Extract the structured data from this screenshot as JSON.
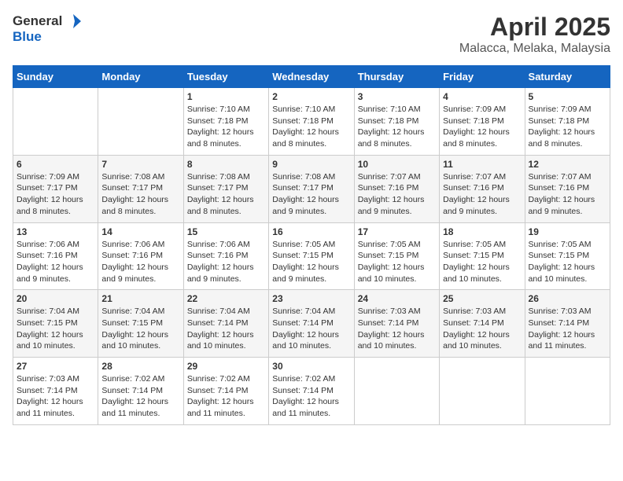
{
  "header": {
    "logo_general": "General",
    "logo_blue": "Blue",
    "title": "April 2025",
    "subtitle": "Malacca, Melaka, Malaysia"
  },
  "weekdays": [
    "Sunday",
    "Monday",
    "Tuesday",
    "Wednesday",
    "Thursday",
    "Friday",
    "Saturday"
  ],
  "weeks": [
    [
      {
        "day": "",
        "detail": ""
      },
      {
        "day": "",
        "detail": ""
      },
      {
        "day": "1",
        "detail": "Sunrise: 7:10 AM\nSunset: 7:18 PM\nDaylight: 12 hours\nand 8 minutes."
      },
      {
        "day": "2",
        "detail": "Sunrise: 7:10 AM\nSunset: 7:18 PM\nDaylight: 12 hours\nand 8 minutes."
      },
      {
        "day": "3",
        "detail": "Sunrise: 7:10 AM\nSunset: 7:18 PM\nDaylight: 12 hours\nand 8 minutes."
      },
      {
        "day": "4",
        "detail": "Sunrise: 7:09 AM\nSunset: 7:18 PM\nDaylight: 12 hours\nand 8 minutes."
      },
      {
        "day": "5",
        "detail": "Sunrise: 7:09 AM\nSunset: 7:18 PM\nDaylight: 12 hours\nand 8 minutes."
      }
    ],
    [
      {
        "day": "6",
        "detail": "Sunrise: 7:09 AM\nSunset: 7:17 PM\nDaylight: 12 hours\nand 8 minutes."
      },
      {
        "day": "7",
        "detail": "Sunrise: 7:08 AM\nSunset: 7:17 PM\nDaylight: 12 hours\nand 8 minutes."
      },
      {
        "day": "8",
        "detail": "Sunrise: 7:08 AM\nSunset: 7:17 PM\nDaylight: 12 hours\nand 8 minutes."
      },
      {
        "day": "9",
        "detail": "Sunrise: 7:08 AM\nSunset: 7:17 PM\nDaylight: 12 hours\nand 9 minutes."
      },
      {
        "day": "10",
        "detail": "Sunrise: 7:07 AM\nSunset: 7:16 PM\nDaylight: 12 hours\nand 9 minutes."
      },
      {
        "day": "11",
        "detail": "Sunrise: 7:07 AM\nSunset: 7:16 PM\nDaylight: 12 hours\nand 9 minutes."
      },
      {
        "day": "12",
        "detail": "Sunrise: 7:07 AM\nSunset: 7:16 PM\nDaylight: 12 hours\nand 9 minutes."
      }
    ],
    [
      {
        "day": "13",
        "detail": "Sunrise: 7:06 AM\nSunset: 7:16 PM\nDaylight: 12 hours\nand 9 minutes."
      },
      {
        "day": "14",
        "detail": "Sunrise: 7:06 AM\nSunset: 7:16 PM\nDaylight: 12 hours\nand 9 minutes."
      },
      {
        "day": "15",
        "detail": "Sunrise: 7:06 AM\nSunset: 7:16 PM\nDaylight: 12 hours\nand 9 minutes."
      },
      {
        "day": "16",
        "detail": "Sunrise: 7:05 AM\nSunset: 7:15 PM\nDaylight: 12 hours\nand 9 minutes."
      },
      {
        "day": "17",
        "detail": "Sunrise: 7:05 AM\nSunset: 7:15 PM\nDaylight: 12 hours\nand 10 minutes."
      },
      {
        "day": "18",
        "detail": "Sunrise: 7:05 AM\nSunset: 7:15 PM\nDaylight: 12 hours\nand 10 minutes."
      },
      {
        "day": "19",
        "detail": "Sunrise: 7:05 AM\nSunset: 7:15 PM\nDaylight: 12 hours\nand 10 minutes."
      }
    ],
    [
      {
        "day": "20",
        "detail": "Sunrise: 7:04 AM\nSunset: 7:15 PM\nDaylight: 12 hours\nand 10 minutes."
      },
      {
        "day": "21",
        "detail": "Sunrise: 7:04 AM\nSunset: 7:15 PM\nDaylight: 12 hours\nand 10 minutes."
      },
      {
        "day": "22",
        "detail": "Sunrise: 7:04 AM\nSunset: 7:14 PM\nDaylight: 12 hours\nand 10 minutes."
      },
      {
        "day": "23",
        "detail": "Sunrise: 7:04 AM\nSunset: 7:14 PM\nDaylight: 12 hours\nand 10 minutes."
      },
      {
        "day": "24",
        "detail": "Sunrise: 7:03 AM\nSunset: 7:14 PM\nDaylight: 12 hours\nand 10 minutes."
      },
      {
        "day": "25",
        "detail": "Sunrise: 7:03 AM\nSunset: 7:14 PM\nDaylight: 12 hours\nand 10 minutes."
      },
      {
        "day": "26",
        "detail": "Sunrise: 7:03 AM\nSunset: 7:14 PM\nDaylight: 12 hours\nand 11 minutes."
      }
    ],
    [
      {
        "day": "27",
        "detail": "Sunrise: 7:03 AM\nSunset: 7:14 PM\nDaylight: 12 hours\nand 11 minutes."
      },
      {
        "day": "28",
        "detail": "Sunrise: 7:02 AM\nSunset: 7:14 PM\nDaylight: 12 hours\nand 11 minutes."
      },
      {
        "day": "29",
        "detail": "Sunrise: 7:02 AM\nSunset: 7:14 PM\nDaylight: 12 hours\nand 11 minutes."
      },
      {
        "day": "30",
        "detail": "Sunrise: 7:02 AM\nSunset: 7:14 PM\nDaylight: 12 hours\nand 11 minutes."
      },
      {
        "day": "",
        "detail": ""
      },
      {
        "day": "",
        "detail": ""
      },
      {
        "day": "",
        "detail": ""
      }
    ]
  ]
}
